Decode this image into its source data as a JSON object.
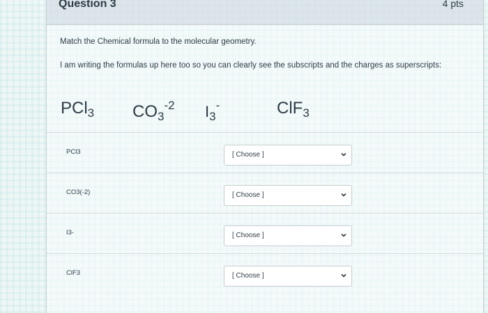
{
  "question": {
    "title": "Question 3",
    "points": "4 pts",
    "instruction": "Match the Chemical formula to the molecular geometry.",
    "note": "I am writing the formulas up here too so you can clearly see the subscripts and the charges as superscripts:"
  },
  "formulas": [
    {
      "base": "PCl",
      "sub": "3",
      "sup": ""
    },
    {
      "base": "CO",
      "sub": "3",
      "sup": "-2"
    },
    {
      "base": "I",
      "sub": "3",
      "sup": "-"
    },
    {
      "base": "ClF",
      "sub": "3",
      "sup": ""
    }
  ],
  "answers": [
    {
      "label": "PCl3",
      "selected": "[ Choose ]"
    },
    {
      "label": "CO3(-2)",
      "selected": "[ Choose ]"
    },
    {
      "label": "I3-",
      "selected": "[ Choose ]"
    },
    {
      "label": "ClF3",
      "selected": "[ Choose ]"
    }
  ],
  "icons": {
    "dropdown": "chevron-down-icon"
  }
}
